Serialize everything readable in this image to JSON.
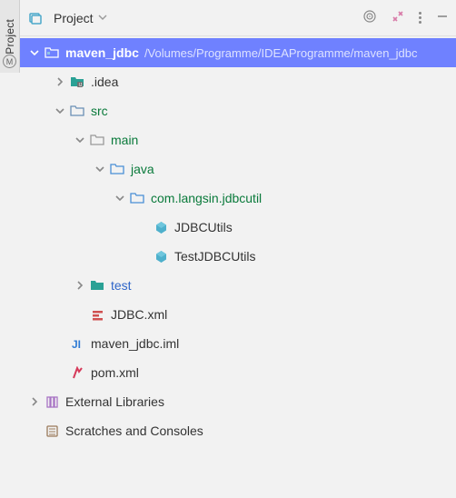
{
  "sidebar": {
    "tab_label": "Project"
  },
  "header": {
    "title": "Project"
  },
  "tree": {
    "root": {
      "name": "maven_jdbc",
      "path": "/Volumes/Programme/IDEAProgramme/maven_jdbc"
    },
    "idea": ".idea",
    "src": "src",
    "main": "main",
    "java": "java",
    "pkg": "com.langsin.jdbcutil",
    "cls1": "JDBCUtils",
    "cls2": "TestJDBCUtils",
    "test": "test",
    "jdbcxml": "JDBC.xml",
    "iml": "maven_jdbc.iml",
    "pom": "pom.xml",
    "extlib": "External Libraries",
    "scratches": "Scratches and Consoles"
  }
}
